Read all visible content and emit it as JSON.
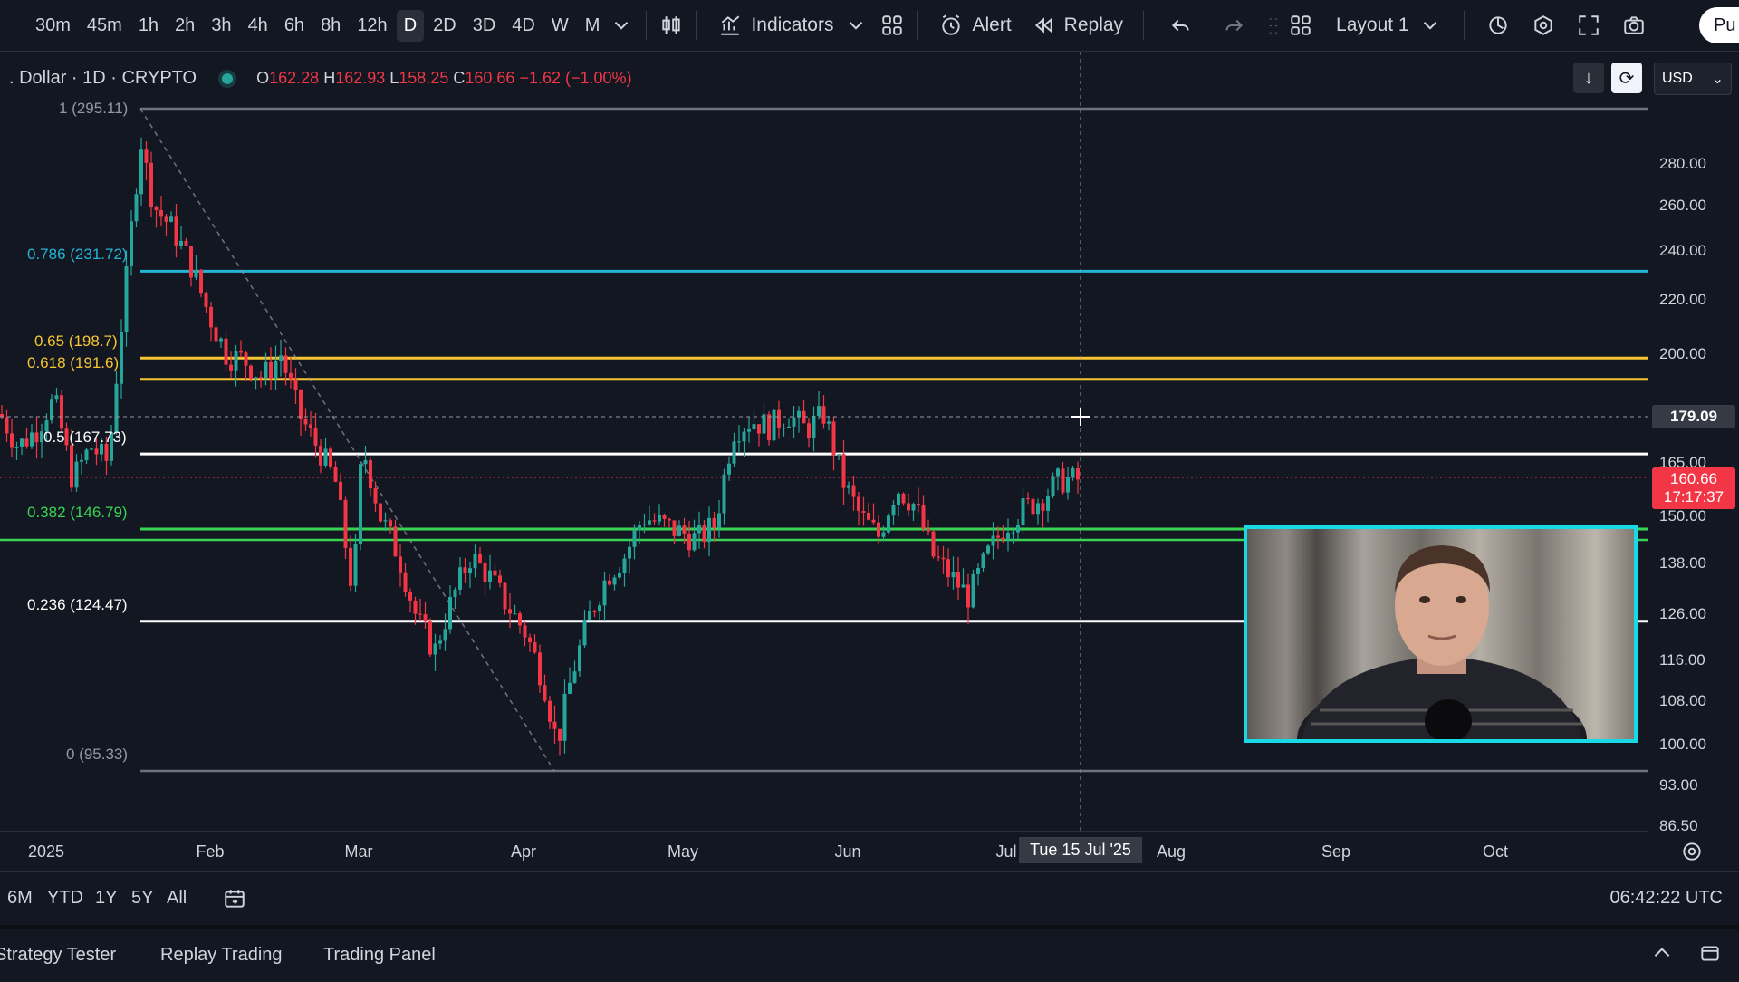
{
  "toolbar": {
    "timeframes": [
      "30m",
      "45m",
      "1h",
      "2h",
      "3h",
      "4h",
      "6h",
      "8h",
      "12h",
      "D",
      "2D",
      "3D",
      "4D",
      "W",
      "M"
    ],
    "active_timeframe": "D",
    "indicators_label": "Indicators",
    "alert_label": "Alert",
    "replay_label": "Replay",
    "layout_label": "Layout 1",
    "publish_label": "Pu"
  },
  "legend": {
    "symbol": ". Dollar · 1D · CRYPTO",
    "o_label": "O",
    "o": "162.28",
    "h_label": "H",
    "h": "162.93",
    "l_label": "L",
    "l": "158.25",
    "c_label": "C",
    "c": "160.66",
    "change": "−1.62 (−1.00%)"
  },
  "currency": "USD",
  "price_axis": {
    "ticks": [
      "280.00",
      "260.00",
      "240.00",
      "220.00",
      "200.00",
      "165.00",
      "150.00",
      "138.00",
      "126.00",
      "116.00",
      "108.00",
      "100.00",
      "93.00",
      "86.50"
    ],
    "crosshair_price": "179.09",
    "last_price": "160.66",
    "countdown": "17:17:37"
  },
  "fib_levels": [
    {
      "label": "1 (295.11)",
      "price": 295.11,
      "color": "#9598a1"
    },
    {
      "label": "0.786 (231.72)",
      "price": 231.72,
      "color": "#22b5d4"
    },
    {
      "label": "0.65 (198.7)",
      "price": 198.7,
      "color": "#f7c531"
    },
    {
      "label": "0.618 (191.6)",
      "price": 191.6,
      "color": "#f7c531"
    },
    {
      "label": "0.5 (167.73)",
      "price": 167.73,
      "color": "#ffffff"
    },
    {
      "label": "0.382 (146.79)",
      "price": 146.79,
      "color": "#39d353"
    },
    {
      "label": "0.236 (124.47)",
      "price": 124.47,
      "color": "#ffffff"
    },
    {
      "label": "0 (95.33)",
      "price": 95.33,
      "color": "#9598a1"
    }
  ],
  "time_axis": {
    "labels": [
      "2025",
      "Feb",
      "Mar",
      "Apr",
      "May",
      "Jun",
      "Jul",
      "Aug",
      "Sep",
      "Oct"
    ],
    "crosshair_date": "Tue 15 Jul '25"
  },
  "range_buttons": [
    "6M",
    "YTD",
    "1Y",
    "5Y",
    "All"
  ],
  "clock": "06:42:22 UTC",
  "bottom_tabs": [
    "Strategy Tester",
    "Replay Trading",
    "Trading Panel"
  ],
  "colors": {
    "up": "#26a69a",
    "down": "#f23645",
    "accent": "#18d9e6"
  },
  "icons": [
    "candles-icon",
    "indicators-icon",
    "templates-icon",
    "alert-icon",
    "replay-icon",
    "undo-icon",
    "redo-icon",
    "layout-icon",
    "quick-search-icon",
    "settings-icon",
    "fullscreen-icon",
    "camera-icon",
    "calendar-icon",
    "chevron-up-icon",
    "maximize-icon"
  ]
}
